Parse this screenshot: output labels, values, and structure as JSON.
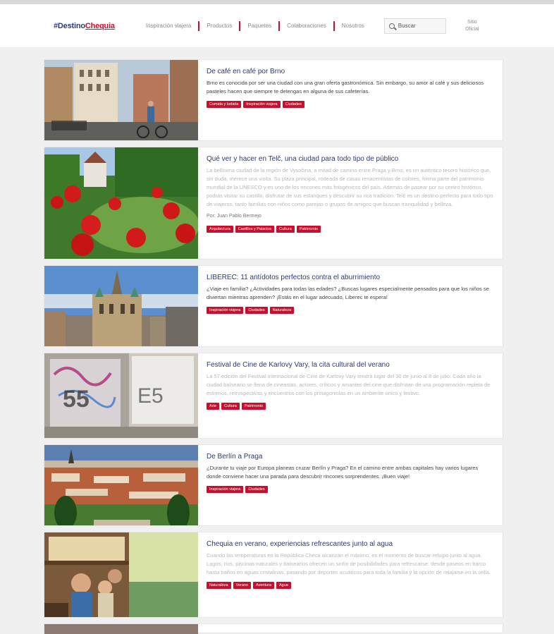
{
  "header": {
    "logo_hash": "#Destino",
    "logo_red": "Chequia",
    "nav": [
      "Inspiración viajera",
      "Productos",
      "Paquetes",
      "Colaboraciones",
      "Nosotros"
    ],
    "search_placeholder": "Buscar",
    "lang_line1": "Sitio",
    "lang_line2": "Oficial"
  },
  "posts": [
    {
      "title": "De café en café por Brno",
      "excerpt": "Brno es conocida por ser una ciudad con una gran oferta gastronómica. Sin embargo, su amor al café y sus deliciosos pasteles hacen que siempre te detengas en alguna de sus cafeterías.",
      "faded": false,
      "tags": [
        "Comida y bebida",
        "Inspiración viajera",
        "Ciudades"
      ]
    },
    {
      "title": "Qué ver y hacer en Telč, una ciudad para todo tipo de público",
      "excerpt": "La bellísima ciudad de la región de Vysočina, a mitad de camino entre Praga y Brno, es un auténtico tesoro histórico que, sin duda, merece una visita. Su plaza principal, rodeada de casas renacentistas de colores, forma parte del patrimonio mundial de la UNESCO y es uno de los rincones más fotogénicos del país. Además de pasear por su centro histórico, podrás visitar su castillo, disfrutar de sus estanques y descubrir su rica tradición. Telč es un destino perfecto para todo tipo de viajeros, tanto familias con niños como parejas o grupos de amigos que buscan tranquilidad y belleza.",
      "faded": true,
      "author": "Por: Juan Pablo Bermejo",
      "tags": [
        "Arquitectura",
        "Castillos y Palacios",
        "Cultura",
        "Patrimonio"
      ]
    },
    {
      "title": "LIBEREC: 11 antídotos perfectos contra el aburrimiento",
      "excerpt": "¿Viaje en familia? ¿Actividades para todas las edades? ¿Buscas lugares especialmente pensados para que los niños se diviertan mientras aprenden? ¡Estás en el lugar adecuado, Liberec te espera!",
      "faded": false,
      "tags": [
        "Inspiración viajera",
        "Ciudades",
        "Naturaleza"
      ]
    },
    {
      "title": "Festival de Cine de Karlovy Vary, la cita cultural del verano",
      "excerpt": "La 57 edición del Festival Internacional de Cine de Karlovy Vary tendrá lugar del 30 de junio al 8 de julio. Cada año la ciudad balneario se llena de cineastas, actores, críticos y amantes del cine que disfrutan de una programación repleta de estrenos, retrospectivas y encuentros con los protagonistas en un ambiente único y festivo.",
      "faded": true,
      "tags": [
        "Arte",
        "Cultura",
        "Patrimonio"
      ]
    },
    {
      "title": "De Berlín a Praga",
      "excerpt": "¿Durante tu viaje por Europa planeas cruzar Berlín y Praga? En el camino entre ambas capitales hay varios lugares donde conviene hacer una parada para descubrir rincones sorprendentes. ¡Buen viaje!",
      "faded": false,
      "tags": [
        "Inspiración viajera",
        "Ciudades"
      ]
    },
    {
      "title": "Chequia en verano, experiencias refrescantes junto al agua",
      "excerpt": "Cuando las temperaturas en la República Checa alcanzan el máximo, es el momento de buscar refugio junto al agua. Lagos, ríos, piscinas naturales y balnearios ofrecen un sinfín de posibilidades para refrescarse: desde paseos en barco hasta baños en aguas cristalinas, pasando por deportes acuáticos para toda la familia y la opción de relajarse en la orilla.",
      "faded": true,
      "tags": [
        "Naturaleza",
        "Verano",
        "Aventura",
        "Agua"
      ]
    }
  ]
}
